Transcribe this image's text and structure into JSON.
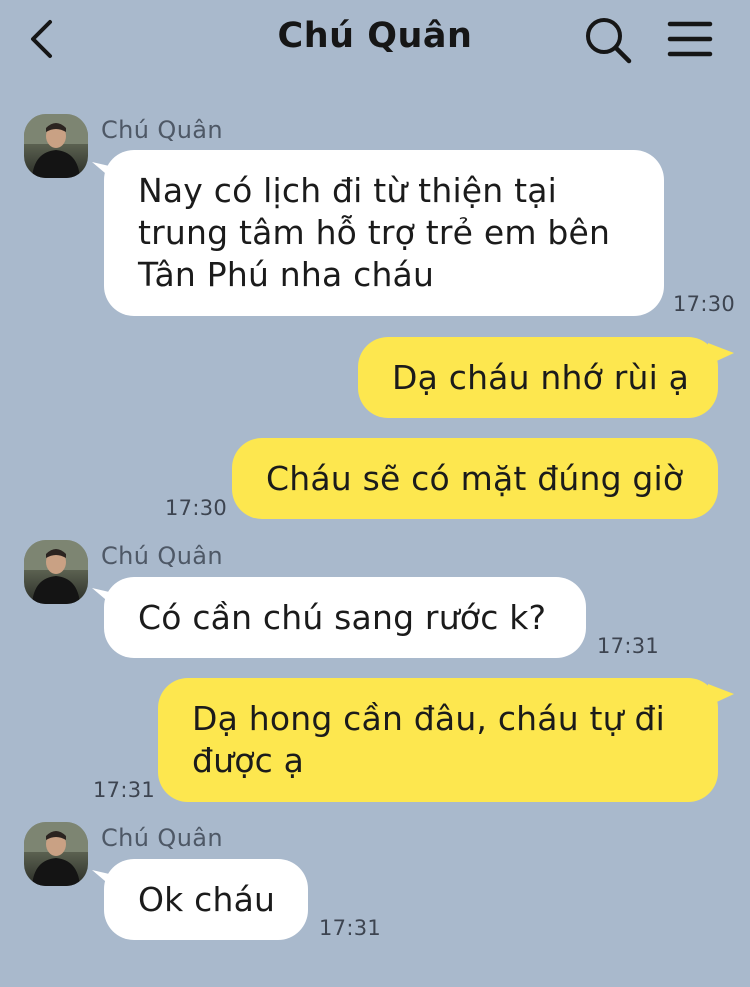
{
  "header": {
    "title": "Chú Quân",
    "back_icon": "chevron-left-icon",
    "search_icon": "search-icon",
    "menu_icon": "hamburger-menu-icon"
  },
  "colors": {
    "background": "#a9b9cc",
    "incoming_bubble": "#ffffff",
    "outgoing_bubble": "#fde74f"
  },
  "messages": [
    {
      "direction": "incoming",
      "sender": "Chú Quân",
      "text": "Nay có lịch đi từ thiện tại trung tâm hỗ trợ trẻ em bên Tân Phú nha cháu",
      "time": "17:30"
    },
    {
      "direction": "outgoing",
      "text": "Dạ cháu nhớ rùi ạ",
      "time": ""
    },
    {
      "direction": "outgoing",
      "text": "Cháu sẽ có mặt đúng giờ",
      "time": "17:30"
    },
    {
      "direction": "incoming",
      "sender": "Chú Quân",
      "text": "Có cần chú sang rước k?",
      "time": "17:31"
    },
    {
      "direction": "outgoing",
      "text": "Dạ hong cần đâu, cháu tự đi được ạ",
      "time": "17:31"
    },
    {
      "direction": "incoming",
      "sender": "Chú Quân",
      "text": "Ok cháu",
      "time": "17:31"
    }
  ]
}
